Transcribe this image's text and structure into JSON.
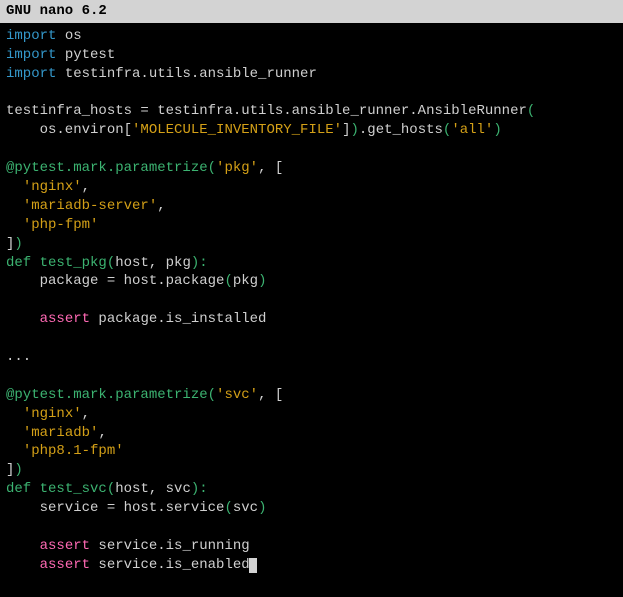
{
  "titlebar": {
    "app": "GNU nano 6.2"
  },
  "code": {
    "l01": {
      "a": "import",
      "b": " os"
    },
    "l02": {
      "a": "import",
      "b": " pytest"
    },
    "l03": {
      "a": "import",
      "b": " testinfra.utils.ansible_runner"
    },
    "l05a": "testinfra_hosts = testinfra.utils.ansible_runner.AnsibleRunner",
    "l05b": "(",
    "l06a": "    os.environ[",
    "l06b": "'MOLECULE_INVENTORY_FILE'",
    "l06c": "]",
    "l06d": ")",
    "l06e": ".get_hosts",
    "l06f": "(",
    "l06g": "'all'",
    "l06h": ")",
    "l08a": "@pytest.mark.parametrize",
    "l08b": "(",
    "l08c": "'pkg'",
    "l08d": ", [",
    "l09a": "  ",
    "l09b": "'nginx'",
    "l09c": ",",
    "l10a": "  ",
    "l10b": "'mariadb-server'",
    "l10c": ",",
    "l11a": "  ",
    "l11b": "'php-fpm'",
    "l12": "]",
    "l12b": ")",
    "l13a": "def",
    "l13b": " ",
    "l13c": "test_pkg",
    "l13d": "(",
    "l13e": "host, pkg",
    "l13f": "):",
    "l14": "    package = host.package",
    "l14b": "(",
    "l14c": "pkg",
    "l14d": ")",
    "l16a": "    ",
    "l16b": "assert",
    "l16c": " package.is_installed",
    "l18": "...",
    "l20a": "@pytest.mark.parametrize",
    "l20b": "(",
    "l20c": "'svc'",
    "l20d": ", [",
    "l21a": "  ",
    "l21b": "'nginx'",
    "l21c": ",",
    "l22a": "  ",
    "l22b": "'mariadb'",
    "l22c": ",",
    "l23a": "  ",
    "l23b": "'php8.1-fpm'",
    "l24": "]",
    "l24b": ")",
    "l25a": "def",
    "l25b": " ",
    "l25c": "test_svc",
    "l25d": "(",
    "l25e": "host, svc",
    "l25f": "):",
    "l26": "    service = host.service",
    "l26b": "(",
    "l26c": "svc",
    "l26d": ")",
    "l28a": "    ",
    "l28b": "assert",
    "l28c": " service.is_running",
    "l29a": "    ",
    "l29b": "assert",
    "l29c": " service.is_enabled"
  }
}
